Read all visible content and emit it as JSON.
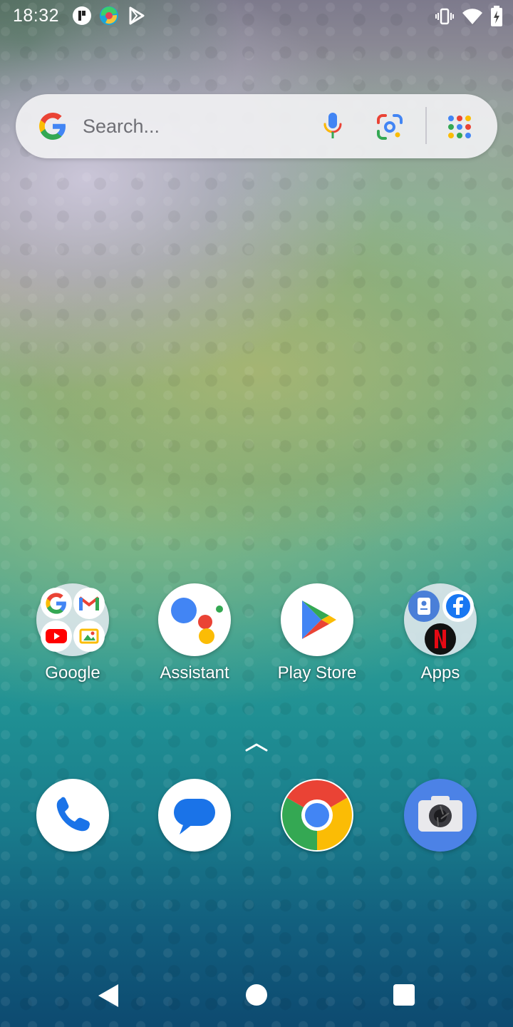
{
  "status_bar": {
    "time": "18:32",
    "left_icons": [
      "notification-app-icon",
      "edge-browser-icon",
      "play-games-icon"
    ],
    "right_icons": [
      "vibrate-icon",
      "wifi-icon",
      "battery-icon"
    ]
  },
  "search": {
    "placeholder": "Search...",
    "icons": [
      "google-g-icon",
      "microphone-icon",
      "google-lens-icon",
      "app-grid-icon"
    ]
  },
  "home_apps": [
    {
      "label": "Google",
      "type": "folder",
      "contents": [
        "google-icon",
        "gmail-icon",
        "youtube-icon",
        "photos-icon"
      ]
    },
    {
      "label": "Assistant",
      "type": "app"
    },
    {
      "label": "Play Store",
      "type": "app"
    },
    {
      "label": "Apps",
      "type": "folder",
      "contents": [
        "contacts-icon",
        "facebook-icon",
        "netflix-icon"
      ]
    }
  ],
  "dock_apps": [
    {
      "name": "phone-icon"
    },
    {
      "name": "messages-icon"
    },
    {
      "name": "chrome-icon"
    },
    {
      "name": "camera-icon"
    }
  ],
  "navigation": [
    "back-button",
    "home-button",
    "recents-button"
  ],
  "colors": {
    "google_blue": "#4285F4",
    "google_red": "#EA4335",
    "google_yellow": "#FBBC05",
    "google_green": "#34A853"
  }
}
